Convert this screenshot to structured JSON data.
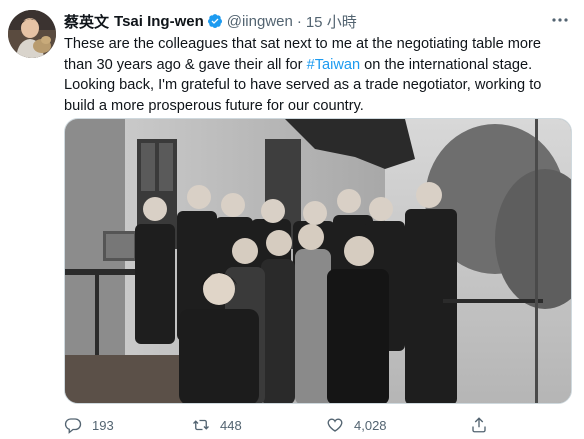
{
  "author": {
    "name_zh": "蔡英文",
    "name_en": "Tsai Ing-wen",
    "handle": "@iingwen",
    "separator": "·",
    "time": "15 小時"
  },
  "tweet": {
    "line1": "These are the colleagues that sat next to me at the negotiating table more",
    "line2_before": "than 30 years ago & gave their all for ",
    "hashtag": "#Taiwan",
    "line2_after": " on the international stage.",
    "line3": "Looking back, I'm grateful to have served as a trade negotiator, working to",
    "line4": "build a more prosperous future for our country."
  },
  "photo": {
    "style": "black-and-white group photo"
  },
  "actions": {
    "reply_count": "193",
    "retweet_count": "448",
    "like_count": "4,028"
  },
  "icons": {
    "verified": "verified-badge-icon",
    "more": "more-options-icon",
    "reply": "reply-icon",
    "retweet": "retweet-icon",
    "like": "like-icon",
    "share": "share-icon"
  },
  "colors": {
    "accent": "#1d9bf0",
    "text": "#0f1419",
    "muted": "#536471"
  }
}
